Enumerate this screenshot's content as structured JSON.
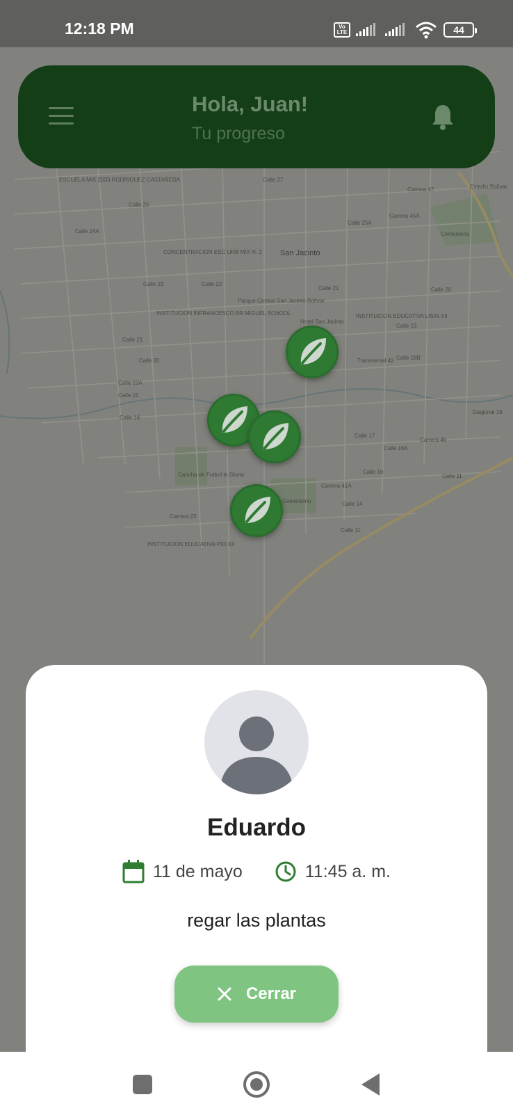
{
  "status_bar": {
    "time": "12:18 PM",
    "volte": "Vo LTE",
    "battery": "44"
  },
  "header": {
    "greeting": "Hola, Juan!",
    "subtitle": "Tu progreso"
  },
  "map": {
    "labels": [
      "ESCUELA MIX 2033 RODRIGUEZ CASTAÑEDA",
      "Calle 27",
      "Carrera 47",
      "Calle 25",
      "Calle 24A",
      "Calle 25A",
      "Carrera 45A",
      "Cementerio",
      "San Jacinto",
      "CONCENTRACION ESC URB MIX N. 2",
      "Calle 23",
      "Calle 22",
      "Calle 21",
      "Parque Central San Jacinto Bolívar",
      "Calle 20",
      "INSTITUCION INFRANCESCO BR MIGUEL SCHOOL",
      "Hotel San Jacinto",
      "INSTITUCION EDUCATIVA LISIN XII",
      "Calle 19",
      "Calle 18B",
      "Calle 21",
      "Calle 20",
      "Calle 19A",
      "Calle 15",
      "Calle 14",
      "Calle 17",
      "Calle 16A",
      "Calle 16",
      "Calle 14",
      "Calle 11",
      "Calle 11",
      "Cancha de Futbol la Gloria",
      "Cementerio",
      "INSTITUCION EDUCATIVA PIO XII",
      "Carrera 23",
      "Carrera 41A",
      "Carrera 46",
      "Diagonal 16",
      "Estadio Bolívar",
      "Transversal 42"
    ]
  },
  "sheet": {
    "name": "Eduardo",
    "date": "11 de mayo",
    "time": "11:45 a. m.",
    "description": "regar las plantas",
    "close_label": "Cerrar"
  },
  "colors": {
    "header_bg": "#143f16",
    "marker": "#2f7a33",
    "accent_green": "#2e7d32",
    "button_bg": "#7fc581"
  }
}
